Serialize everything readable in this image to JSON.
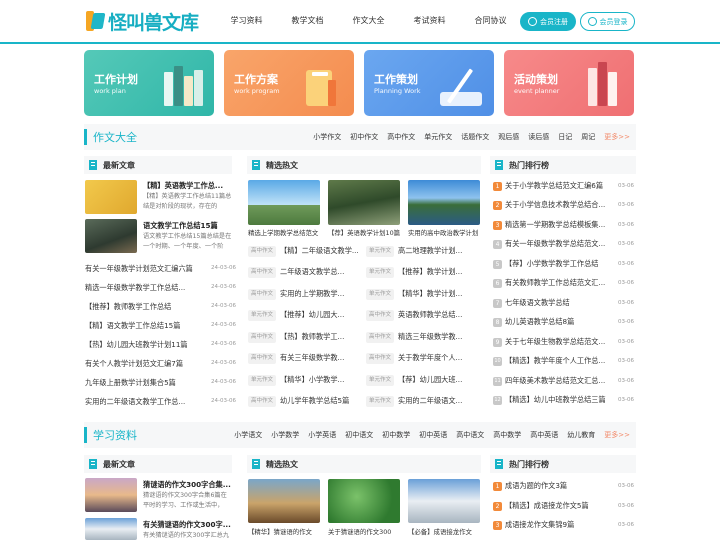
{
  "header": {
    "logo_text": "怪叫兽文库",
    "nav": [
      "学习资料",
      "教学文档",
      "作文大全",
      "考试资料",
      "合同协议"
    ],
    "register_label": "会员注册",
    "login_label": "会员登录",
    "accent_color": "#19b5c8"
  },
  "banners": [
    {
      "title": "工作计划",
      "subtitle": "work plan"
    },
    {
      "title": "工作方案",
      "subtitle": "work program"
    },
    {
      "title": "工作策划",
      "subtitle": "Planning Work"
    },
    {
      "title": "活动策划",
      "subtitle": "event planner"
    }
  ],
  "sections": [
    {
      "title": "作文大全",
      "links": [
        "小学作文",
        "初中作文",
        "高中作文",
        "单元作文",
        "话题作文",
        "观后感",
        "读后感",
        "日记",
        "周记"
      ],
      "more": "更多>>",
      "latest": {
        "heading": "最新文章",
        "featured": [
          {
            "title": "【精】英语教学工作总...",
            "desc": "【精】英语教学工作总结11篇总结是对阶段的现状，存在的"
          },
          {
            "title": "语文教学工作总结15篇",
            "desc": "语文教学工作总结15篇总结是在一个时期、一个年度、一个阶"
          }
        ],
        "items": [
          {
            "title": "有关一年级教学计划范文汇编六篇",
            "date": "24-03-06"
          },
          {
            "title": "精选一年级数学教学工作总结...",
            "date": "24-03-06"
          },
          {
            "title": "【推荐】教师教学工作总结",
            "date": "24-03-06"
          },
          {
            "title": "【精】语文教学工作总结15篇",
            "date": "24-03-06"
          },
          {
            "title": "【热】幼儿园大班教学计划11篇",
            "date": "24-03-06"
          },
          {
            "title": "有关个人教学计划范文汇编7篇",
            "date": "24-03-06"
          },
          {
            "title": "九年级上册数学计划集合5篇",
            "date": "24-03-06"
          },
          {
            "title": "实用的二年级语文教学工作总...",
            "date": "24-03-06"
          }
        ]
      },
      "hot": {
        "heading": "精选热文",
        "images": [
          "精选上学期教学总结范文",
          "【荐】英语教学计划10篇",
          "实用的高中政治教学计划"
        ],
        "tag": "高中作文",
        "tag2": "单元作文",
        "rows": [
          [
            "【精】二年级语文教学...",
            "高二地理教学计划..."
          ],
          [
            "二年级语文教学总...",
            "【推荐】教学计划..."
          ],
          [
            "实用的上学期教学...",
            "【精华】教学计划..."
          ],
          [
            "【推荐】幼儿园大...",
            "英语教师教学总结..."
          ],
          [
            "【热】教师教学工...",
            "精选三年级数学教..."
          ],
          [
            "有关三年级数学教...",
            "关于教学年度个人..."
          ],
          [
            "【精华】小学教学...",
            "【荐】幼儿园大班..."
          ],
          [
            "幼儿学年教学总结5篇",
            "实用的二年级语文..."
          ]
        ]
      },
      "rank": {
        "heading": "热门排行榜",
        "items": [
          {
            "title": "关于小学教学总结范文汇编6篇",
            "date": "03-06"
          },
          {
            "title": "关于小学信息技术教学总结合...",
            "date": "03-06"
          },
          {
            "title": "精选第一学期教学总结模板集...",
            "date": "03-06"
          },
          {
            "title": "有关一年级数学教学总结范文...",
            "date": "03-06"
          },
          {
            "title": "【荐】小学数学教学工作总结",
            "date": "03-06"
          },
          {
            "title": "有关教师教学工作总结范文汇...",
            "date": "03-06"
          },
          {
            "title": "七年级语文教学总结",
            "date": "03-06"
          },
          {
            "title": "幼儿英语教学总结8篇",
            "date": "03-06"
          },
          {
            "title": "关于七年级生物教学总结范文...",
            "date": "03-06"
          },
          {
            "title": "【精选】教学年度个人工作总...",
            "date": "03-06"
          },
          {
            "title": "四年级美术教学总结范文汇总...",
            "date": "03-06"
          },
          {
            "title": "【精选】幼儿中班教学总结三篇",
            "date": "03-06"
          }
        ]
      }
    },
    {
      "title": "学习资料",
      "links": [
        "小学语文",
        "小学数学",
        "小学英语",
        "初中语文",
        "初中数学",
        "初中英语",
        "高中语文",
        "高中数学",
        "高中英语",
        "幼儿教育"
      ],
      "more": "更多>>",
      "latest": {
        "heading": "最新文章",
        "featured": [
          {
            "title": "猜谜语的作文300字合集...",
            "desc": "猜谜语的作文300字合集6篇在平时的学习、工作或生活中，"
          },
          {
            "title": "有关猜谜语的作文300字...",
            "desc": "有关猜谜语的作文300字汇总九"
          }
        ]
      },
      "hot": {
        "heading": "精选热文",
        "images": [
          "【精华】猜谜语的作文",
          "关于猜谜语的作文300",
          "【必备】成语接龙作文"
        ]
      },
      "rank": {
        "heading": "热门排行榜",
        "items": [
          {
            "title": "成语为题的作文3篇",
            "date": "03-06"
          },
          {
            "title": "【精选】成语接龙作文5篇",
            "date": "03-06"
          },
          {
            "title": "成语接龙作文集锦9篇",
            "date": "03-06"
          }
        ]
      }
    }
  ]
}
